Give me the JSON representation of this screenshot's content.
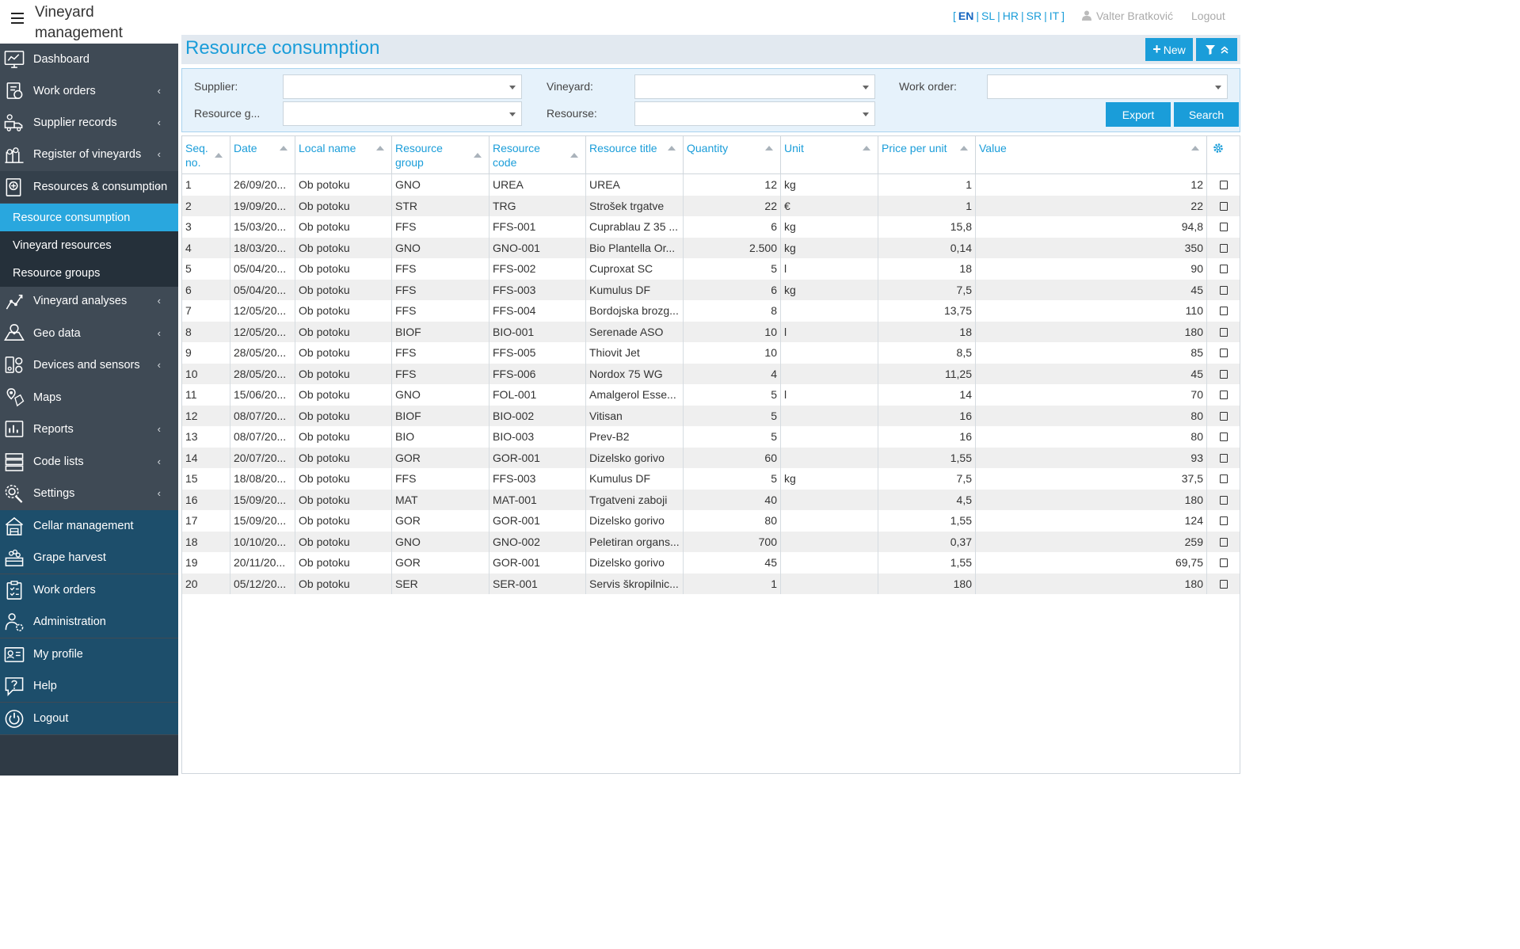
{
  "app": {
    "title_line1": "Vineyard",
    "title_line2": "management"
  },
  "header": {
    "languages": [
      {
        "code": "EN",
        "active": true
      },
      {
        "code": "SL",
        "active": false
      },
      {
        "code": "HR",
        "active": false
      },
      {
        "code": "SR",
        "active": false
      },
      {
        "code": "IT",
        "active": false
      }
    ],
    "lang_open": "[",
    "lang_close": "]",
    "user_name": "Valter Bratković",
    "logout_label": "Logout"
  },
  "sidebar": {
    "items": [
      {
        "label": "Dashboard",
        "icon": "dashboard-icon",
        "chevron": false
      },
      {
        "label": "Work orders",
        "icon": "work-orders-icon",
        "chevron": true
      },
      {
        "label": "Supplier records",
        "icon": "supplier-icon",
        "chevron": true
      },
      {
        "label": "Register of vineyards",
        "icon": "vineyard-icon",
        "chevron": true
      },
      {
        "label": "Resources & consumption",
        "icon": "resources-icon",
        "chevron": true
      },
      {
        "label": "Vineyard analyses",
        "icon": "analyses-icon",
        "chevron": true
      },
      {
        "label": "Geo data",
        "icon": "geo-icon",
        "chevron": true
      },
      {
        "label": "Devices and sensors",
        "icon": "devices-icon",
        "chevron": true
      },
      {
        "label": "Maps",
        "icon": "maps-icon",
        "chevron": false
      },
      {
        "label": "Reports",
        "icon": "reports-icon",
        "chevron": true
      },
      {
        "label": "Code lists",
        "icon": "code-lists-icon",
        "chevron": true
      },
      {
        "label": "Settings",
        "icon": "settings-icon",
        "chevron": true
      },
      {
        "label": "Cellar management",
        "icon": "cellar-icon",
        "chevron": false
      },
      {
        "label": "Grape harvest",
        "icon": "harvest-icon",
        "chevron": false
      },
      {
        "label": "Work orders",
        "icon": "clipboard-icon",
        "chevron": false
      },
      {
        "label": "Administration",
        "icon": "admin-icon",
        "chevron": false
      },
      {
        "label": "My profile",
        "icon": "profile-icon",
        "chevron": false
      },
      {
        "label": "Help",
        "icon": "help-icon",
        "chevron": false
      },
      {
        "label": "Logout",
        "icon": "power-icon",
        "chevron": false
      }
    ],
    "subitems": [
      {
        "label": "Resource consumption",
        "active": true
      },
      {
        "label": "Vineyard resources",
        "active": false
      },
      {
        "label": "Resource groups",
        "active": false
      }
    ],
    "chevron_glyph": "‹"
  },
  "page": {
    "title": "Resource consumption",
    "new_label": "New"
  },
  "filters": {
    "supplier_label": "Supplier:",
    "vineyard_label": "Vineyard:",
    "work_order_label": "Work order:",
    "resource_group_label": "Resource g...",
    "resource_label": "Resourse:",
    "export_label": "Export",
    "search_label": "Search"
  },
  "table": {
    "columns": [
      {
        "label": "Seq. no.",
        "line1": "Seq.",
        "line2": "no."
      },
      {
        "label": "Date",
        "line1": "Date",
        "line2": ""
      },
      {
        "label": "Local name",
        "line1": "Local name",
        "line2": ""
      },
      {
        "label": "Resource group",
        "line1": "Resource",
        "line2": "group"
      },
      {
        "label": "Resource code",
        "line1": "Resource",
        "line2": "code"
      },
      {
        "label": "Resource title",
        "line1": "Resource title",
        "line2": ""
      },
      {
        "label": "Quantity",
        "line1": "Quantity",
        "line2": ""
      },
      {
        "label": "Unit",
        "line1": "Unit",
        "line2": ""
      },
      {
        "label": "Price per unit",
        "line1": "Price per unit",
        "line2": ""
      },
      {
        "label": "Value",
        "line1": "Value",
        "line2": ""
      }
    ],
    "rows": [
      [
        "1",
        "26/09/20...",
        "Ob potoku",
        "GNO",
        "UREA",
        "UREA",
        "12",
        "kg",
        "1",
        "12"
      ],
      [
        "2",
        "19/09/20...",
        "Ob potoku",
        "STR",
        "TRG",
        "Strošek trgatve",
        "22",
        "€",
        "1",
        "22"
      ],
      [
        "3",
        "15/03/20...",
        "Ob potoku",
        "FFS",
        "FFS-001",
        "Cuprablau Z 35 ...",
        "6",
        "kg",
        "15,8",
        "94,8"
      ],
      [
        "4",
        "18/03/20...",
        "Ob potoku",
        "GNO",
        "GNO-001",
        "Bio Plantella Or...",
        "2.500",
        "kg",
        "0,14",
        "350"
      ],
      [
        "5",
        "05/04/20...",
        "Ob potoku",
        "FFS",
        "FFS-002",
        "Cuproxat SC",
        "5",
        "l",
        "18",
        "90"
      ],
      [
        "6",
        "05/04/20...",
        "Ob potoku",
        "FFS",
        "FFS-003",
        "Kumulus DF",
        "6",
        "kg",
        "7,5",
        "45"
      ],
      [
        "7",
        "12/05/20...",
        "Ob potoku",
        "FFS",
        "FFS-004",
        "Bordojska brozg...",
        "8",
        "",
        "13,75",
        "110"
      ],
      [
        "8",
        "12/05/20...",
        "Ob potoku",
        "BIOF",
        "BIO-001",
        "Serenade ASO",
        "10",
        "l",
        "18",
        "180"
      ],
      [
        "9",
        "28/05/20...",
        "Ob potoku",
        "FFS",
        "FFS-005",
        "Thiovit Jet",
        "10",
        "",
        "8,5",
        "85"
      ],
      [
        "10",
        "28/05/20...",
        "Ob potoku",
        "FFS",
        "FFS-006",
        "Nordox 75 WG",
        "4",
        "",
        "11,25",
        "45"
      ],
      [
        "11",
        "15/06/20...",
        "Ob potoku",
        "GNO",
        "FOL-001",
        "Amalgerol Esse...",
        "5",
        "l",
        "14",
        "70"
      ],
      [
        "12",
        "08/07/20...",
        "Ob potoku",
        "BIOF",
        "BIO-002",
        "Vitisan",
        "5",
        "",
        "16",
        "80"
      ],
      [
        "13",
        "08/07/20...",
        "Ob potoku",
        "BIO",
        "BIO-003",
        "Prev-B2",
        "5",
        "",
        "16",
        "80"
      ],
      [
        "14",
        "20/07/20...",
        "Ob potoku",
        "GOR",
        "GOR-001",
        "Dizelsko gorivo",
        "60",
        "",
        "1,55",
        "93"
      ],
      [
        "15",
        "18/08/20...",
        "Ob potoku",
        "FFS",
        "FFS-003",
        "Kumulus DF",
        "5",
        "kg",
        "7,5",
        "37,5"
      ],
      [
        "16",
        "15/09/20...",
        "Ob potoku",
        "MAT",
        "MAT-001",
        "Trgatveni zaboji",
        "40",
        "",
        "4,5",
        "180"
      ],
      [
        "17",
        "15/09/20...",
        "Ob potoku",
        "GOR",
        "GOR-001",
        "Dizelsko gorivo",
        "80",
        "",
        "1,55",
        "124"
      ],
      [
        "18",
        "10/10/20...",
        "Ob potoku",
        "GNO",
        "GNO-002",
        "Peletiran organs...",
        "700",
        "",
        "0,37",
        "259"
      ],
      [
        "19",
        "20/11/20...",
        "Ob potoku",
        "GOR",
        "GOR-001",
        "Dizelsko gorivo",
        "45",
        "",
        "1,55",
        "69,75"
      ],
      [
        "20",
        "05/12/20...",
        "Ob potoku",
        "SER",
        "SER-001",
        "Servis škropilnic...",
        "1",
        "",
        "180",
        "180"
      ]
    ]
  },
  "colors": {
    "accent": "#1a9dd9",
    "sidebar_dark": "#3f4a55",
    "sidebar_teal": "#1d4e6b",
    "sidebar_active": "#29a7de",
    "row_alt": "#efefef"
  }
}
